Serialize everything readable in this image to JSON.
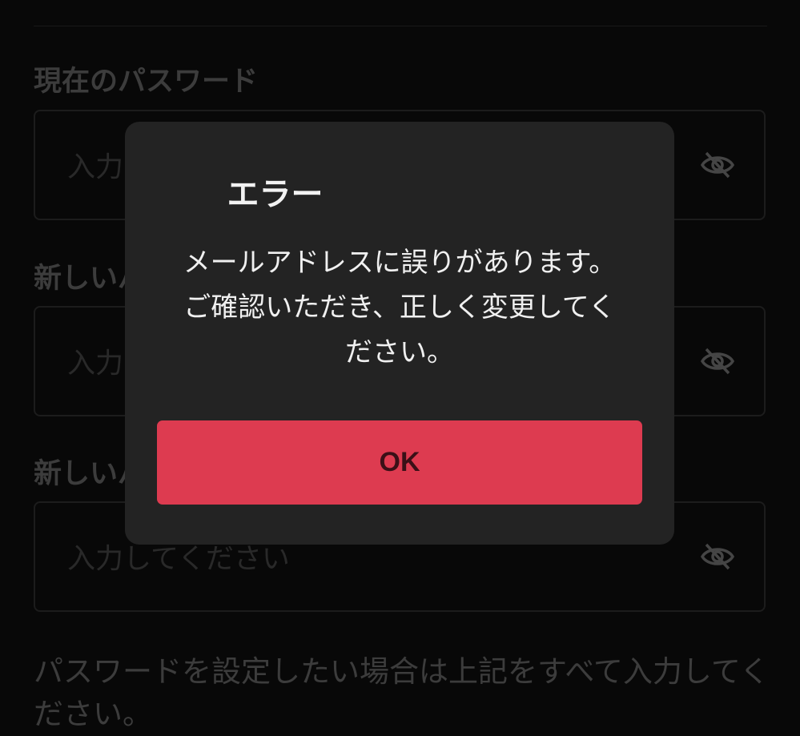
{
  "form": {
    "fields": [
      {
        "label": "現在のパスワード",
        "placeholder": "入力してください"
      },
      {
        "label": "新しいパスワード",
        "placeholder": "入力してください"
      },
      {
        "label": "新しいパスワード(確認)",
        "placeholder": "入力してください"
      }
    ],
    "hint": "パスワードを設定したい場合は上記をすべて入力してください。"
  },
  "dialog": {
    "title": "エラー",
    "message_lines": [
      "メールアドレスに誤りがあります。",
      "ご確認いただき、正しく変更してく",
      "ださい。"
    ],
    "ok_label": "OK"
  },
  "colors": {
    "background": "#0d0d0d",
    "dialog_bg": "#232323",
    "accent": "#dd3b50"
  },
  "icons": {
    "password_toggle": "eye-off-icon"
  }
}
